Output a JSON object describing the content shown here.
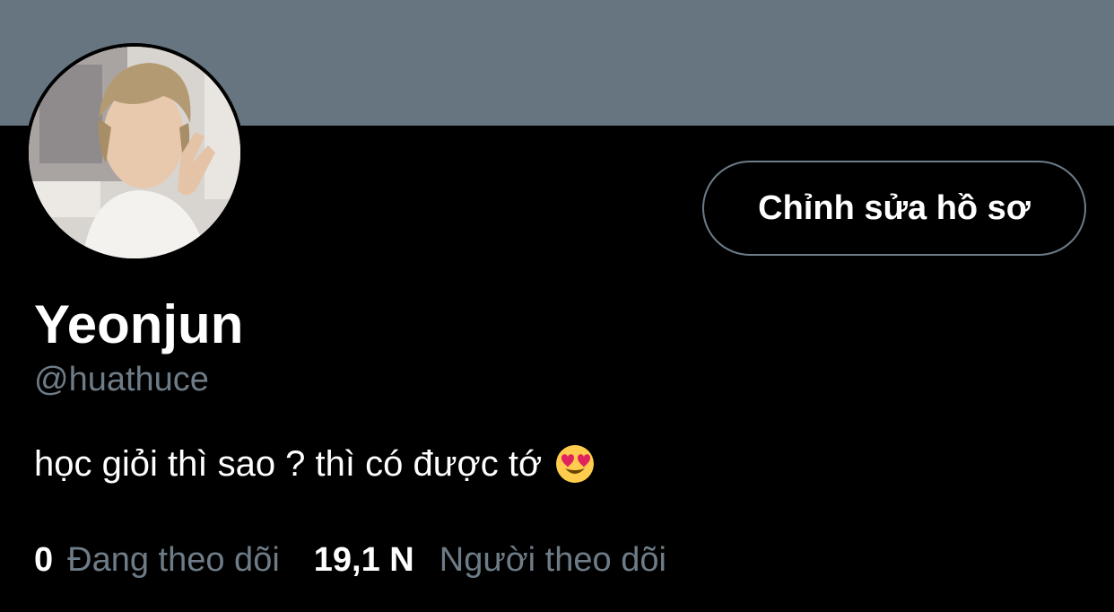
{
  "profile": {
    "display_name": "Yeonjun",
    "handle": "@huathuce",
    "bio": "học giỏi thì sao ? thì có được tớ",
    "bio_emoji_icon": "heart-eyes-emoji-icon",
    "avatar_alt": "profile-photo"
  },
  "actions": {
    "edit_profile_label": "Chỉnh sửa hồ sơ"
  },
  "stats": {
    "following_count": "0",
    "following_label": "Đang theo dõi",
    "followers_count": "19,1 N",
    "followers_label": "Người theo dõi"
  },
  "colors": {
    "background": "#000000",
    "banner": "#66757f",
    "primary_text": "#ffffff",
    "secondary_text": "#6e7c87",
    "button_border": "#6e7c87"
  }
}
